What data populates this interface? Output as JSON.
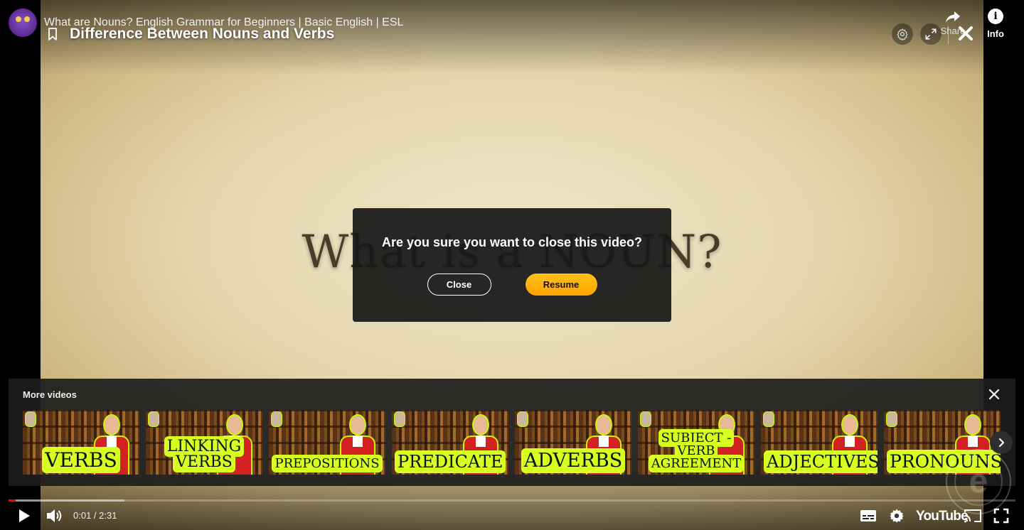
{
  "player": {
    "video_title": "What are Nouns? English Grammar for Beginners | Basic English | ESL",
    "overlay_title": "Difference Between Nouns and Verbs",
    "video_frame_text": "What is a NOUN?",
    "share_label": "Share",
    "info_label": "Info",
    "info_glyph": "i"
  },
  "dialog": {
    "question": "Are you sure you want to close this video?",
    "close_label": "Close",
    "resume_label": "Resume"
  },
  "more_videos": {
    "title": "More videos",
    "items": [
      {
        "label": "VERBS",
        "size": "28px"
      },
      {
        "label": "LINKING VERBS",
        "size": "22px"
      },
      {
        "label": "PREPOSITIONS",
        "size": "18px"
      },
      {
        "label": "PREDICATE",
        "size": "24px"
      },
      {
        "label": "ADVERBS",
        "size": "27px"
      },
      {
        "label": "SUBJECT - VERB AGREEMENT",
        "size": "18px"
      },
      {
        "label": "ADJECTIVES",
        "size": "24px"
      },
      {
        "label": "PRONOUNS",
        "size": "25px"
      }
    ]
  },
  "controls": {
    "time": "0:01 / 2:31",
    "logo": "YouTube",
    "progress_played_pct": 0.7,
    "progress_loaded_pct": 11.5
  },
  "colors": {
    "accent_yellow": "#ffb300",
    "progress_red": "#ff0000",
    "thumb_highlight": "#d7ff1f"
  }
}
